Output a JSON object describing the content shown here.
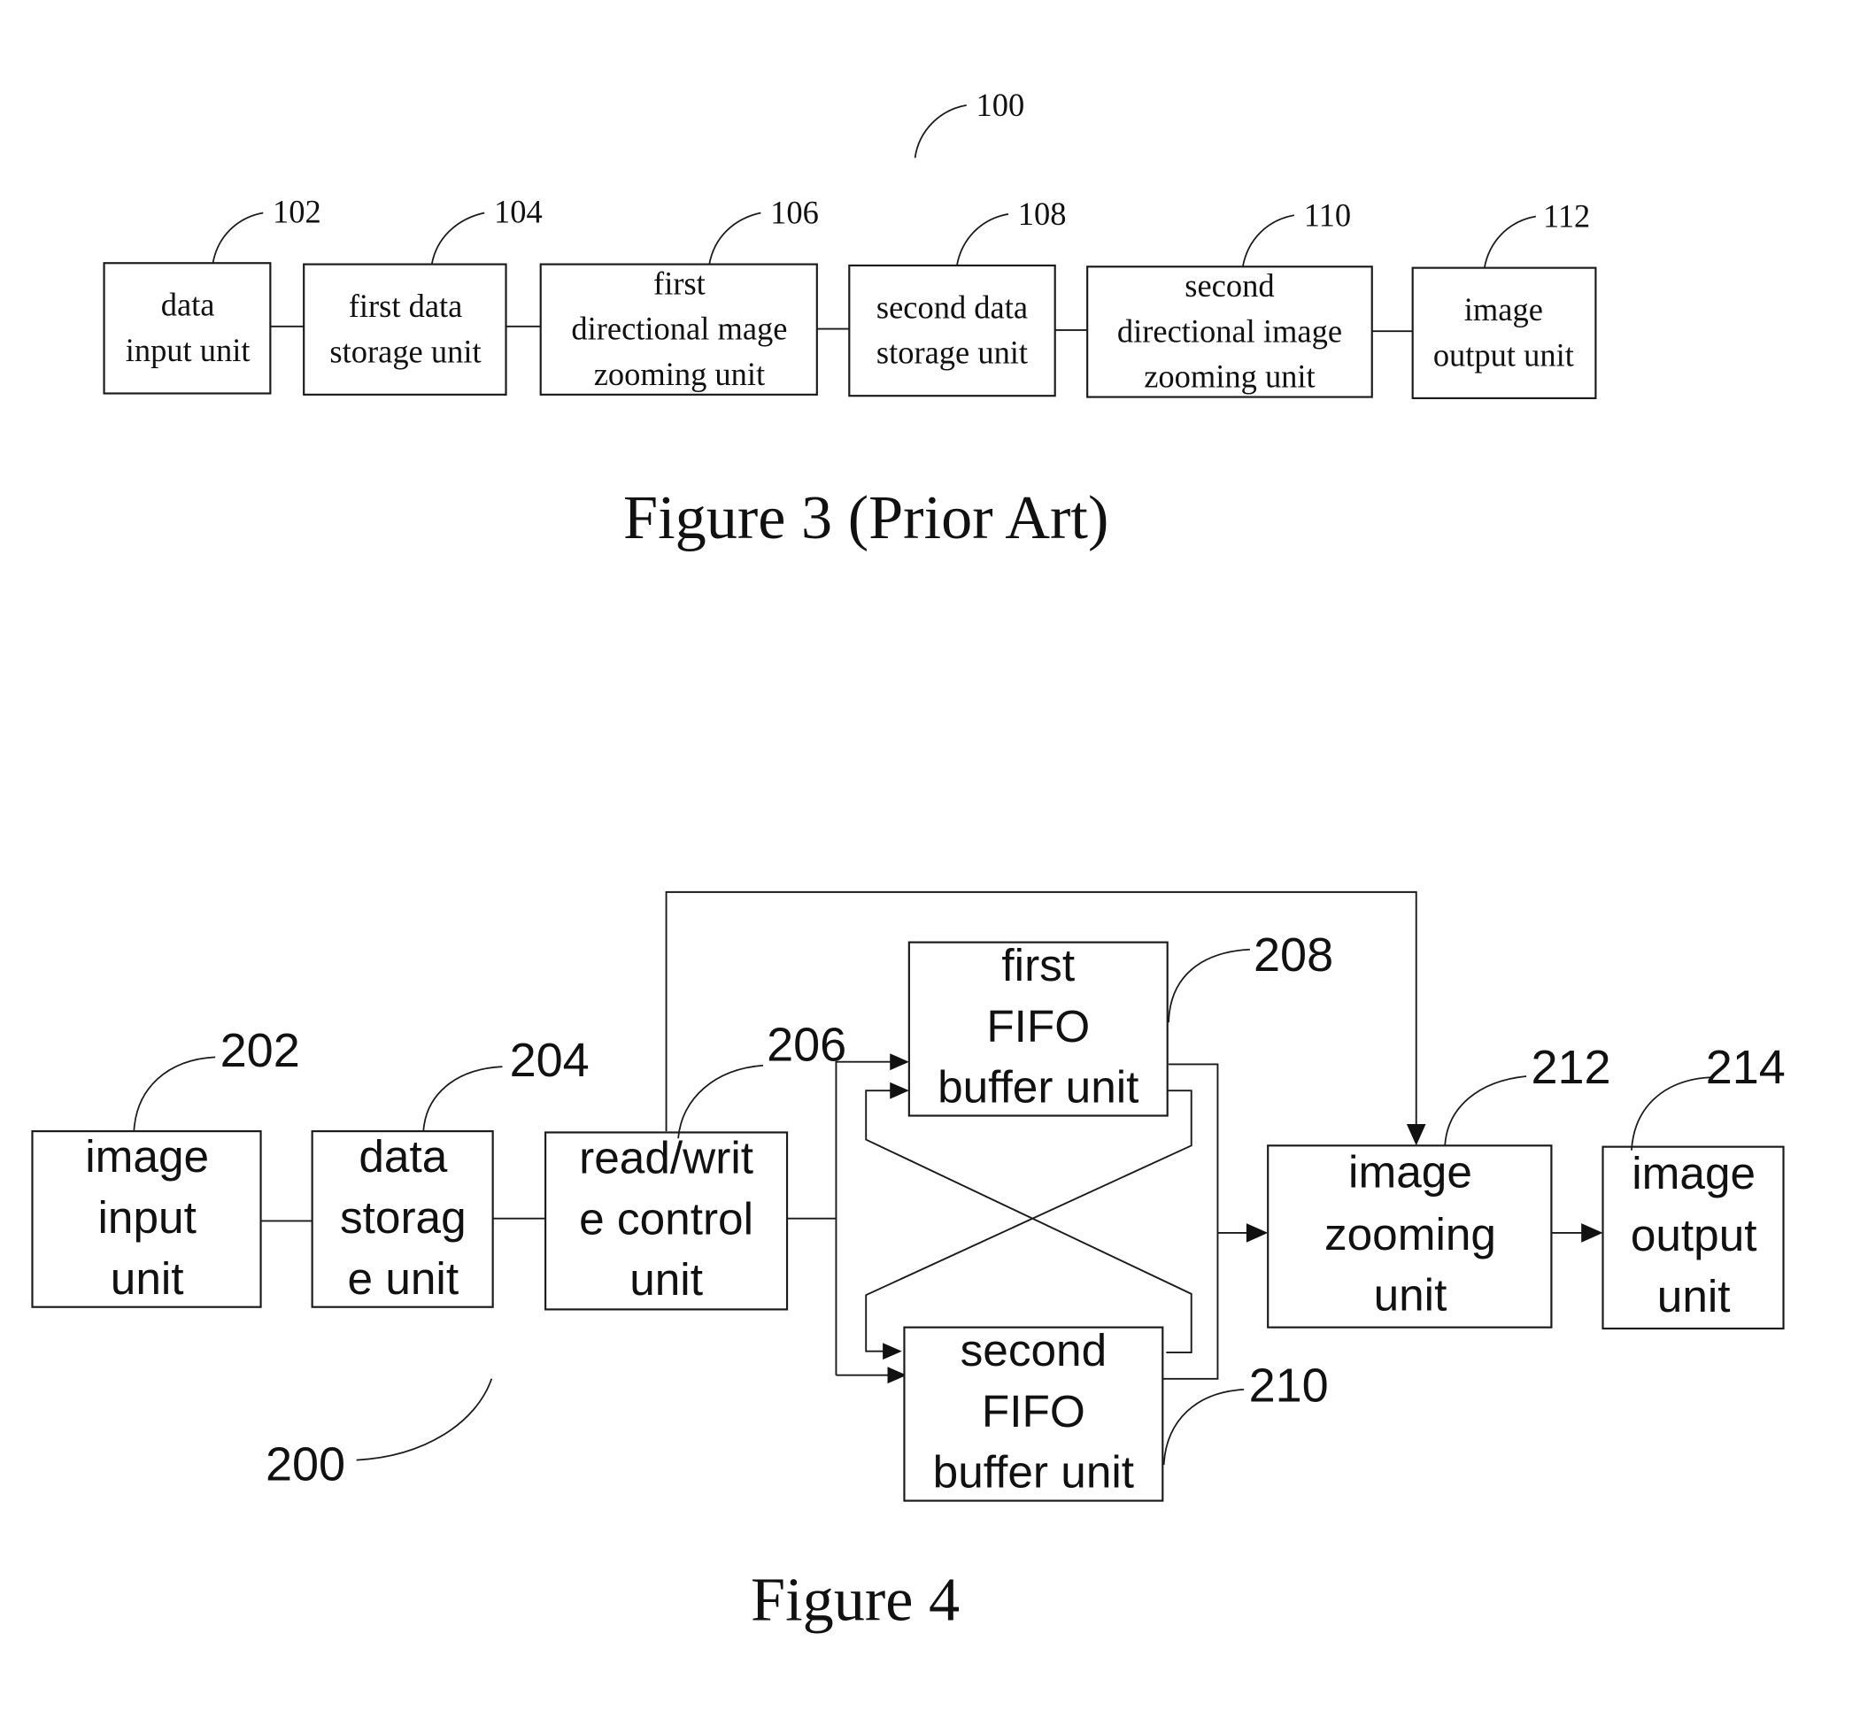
{
  "figure3": {
    "caption": "Figure 3 (Prior Art)",
    "system_ref": "100",
    "blocks": [
      {
        "ref": "102",
        "lines": [
          "data",
          "input unit"
        ]
      },
      {
        "ref": "104",
        "lines": [
          "first data",
          "storage unit"
        ]
      },
      {
        "ref": "106",
        "lines": [
          "first",
          "directional mage",
          "zooming unit"
        ]
      },
      {
        "ref": "108",
        "lines": [
          "second data",
          "storage unit"
        ]
      },
      {
        "ref": "110",
        "lines": [
          "second",
          "directional image",
          "zooming unit"
        ]
      },
      {
        "ref": "112",
        "lines": [
          "image",
          "output unit"
        ]
      }
    ]
  },
  "figure4": {
    "caption": "Figure 4",
    "system_ref": "200",
    "blocks": [
      {
        "ref": "202",
        "lines": [
          "image",
          "input",
          "unit"
        ]
      },
      {
        "ref": "204",
        "lines": [
          "data",
          "storag",
          "e unit"
        ]
      },
      {
        "ref": "206",
        "lines": [
          "read/writ",
          "e control",
          "unit"
        ]
      },
      {
        "ref": "208",
        "lines": [
          "first",
          "FIFO",
          "buffer unit"
        ]
      },
      {
        "ref": "210",
        "lines": [
          "second",
          "FIFO",
          "buffer unit"
        ]
      },
      {
        "ref": "212",
        "lines": [
          "image",
          "zooming",
          "unit"
        ]
      },
      {
        "ref": "214",
        "lines": [
          "image",
          "output",
          "unit"
        ]
      }
    ]
  }
}
